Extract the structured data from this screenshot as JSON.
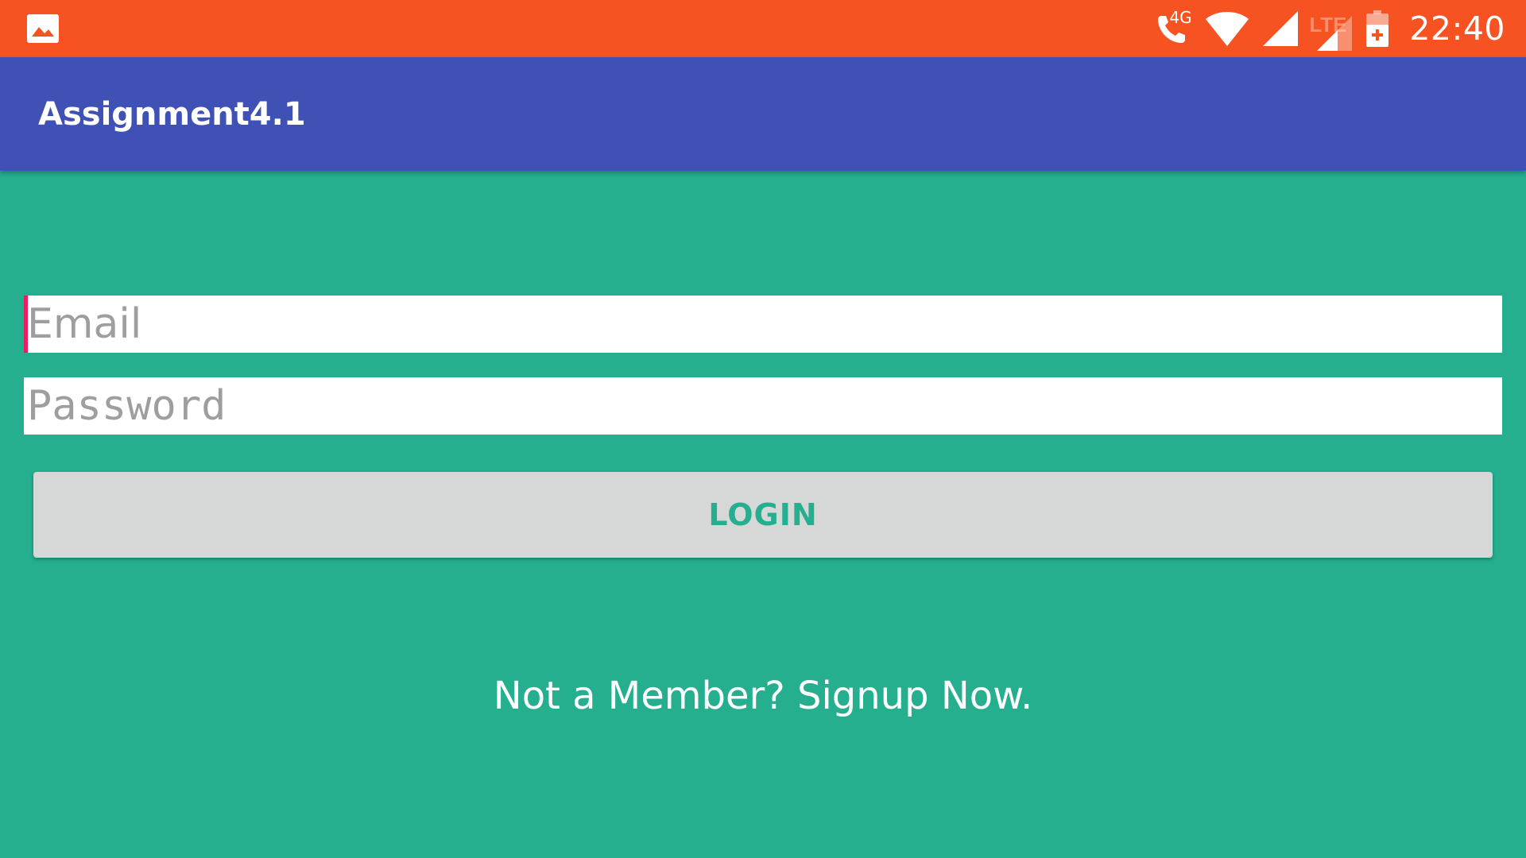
{
  "status_bar": {
    "time": "22:40",
    "network_label": "4G",
    "lte_label": "LTE",
    "icons": [
      "image-icon",
      "phone-4g-icon",
      "wifi-icon",
      "signal-icon",
      "signal-lte-icon",
      "battery-charging-icon"
    ],
    "color": "#F75322"
  },
  "app_bar": {
    "title": "Assignment4.1",
    "color": "#3F51B5"
  },
  "form": {
    "email_placeholder": "Email",
    "password_placeholder": "Password",
    "login_label": "LOGIN",
    "signup_text": "Not a Member? Signup Now."
  },
  "colors": {
    "background": "#25AF8F",
    "button": "#D6D7D7",
    "cursor": "#E91E63"
  }
}
